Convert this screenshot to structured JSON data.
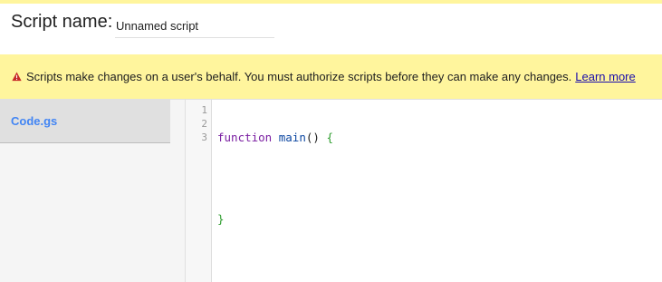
{
  "header": {
    "script_label": "Script name:",
    "script_name_value": "Unnamed script"
  },
  "banner": {
    "icon": "warning-triangle-icon",
    "message": "Scripts make changes on a user's behalf. You must authorize scripts before they can make any changes.",
    "link_label": "Learn more",
    "color": "#fff59d"
  },
  "sidebar": {
    "files": [
      {
        "label": "Code.gs"
      }
    ]
  },
  "editor": {
    "line_numbers": [
      "1",
      "2",
      "3"
    ],
    "code": {
      "line1": {
        "keyword": "function",
        "name": "main",
        "parens": "()",
        "brace_open": "{"
      },
      "line3": {
        "brace_close": "}"
      }
    }
  },
  "colors": {
    "accent": "#4285f4",
    "banner": "#fff59d",
    "warning_icon": "#c62828",
    "link": "#1a0dab",
    "keyword": "#7b1fa2",
    "function_name": "#0d47a1",
    "brace": "#2e9d2e"
  }
}
